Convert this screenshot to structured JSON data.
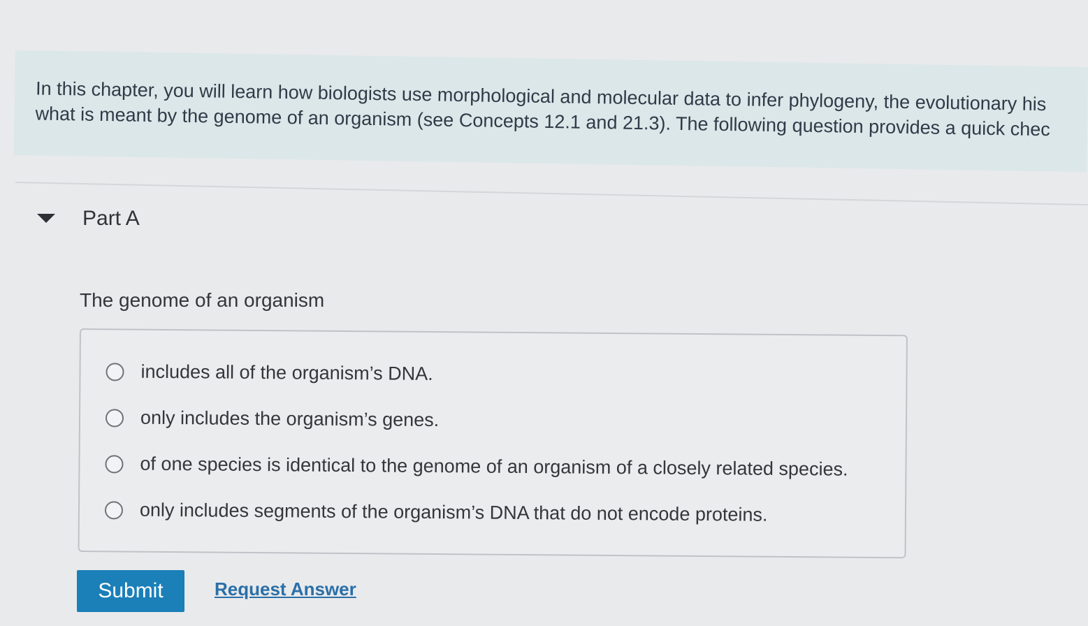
{
  "intro": {
    "line1": "In this chapter, you will learn how biologists use morphological and molecular data to infer phylogeny, the evolutionary his",
    "line2": "what is meant by the genome of an organism (see Concepts 12.1 and 21.3). The following question provides a quick chec"
  },
  "part": {
    "toggle_icon": "caret-down-icon",
    "title": "Part A"
  },
  "question": {
    "stem": "The genome of an organism",
    "choices": [
      {
        "label": "includes all of the organism’s DNA."
      },
      {
        "label": "only includes the organism’s genes."
      },
      {
        "label": "of one species is identical to the genome of an organism of a closely related species."
      },
      {
        "label": "only includes segments of the organism’s DNA that do not encode proteins."
      }
    ]
  },
  "actions": {
    "submit_label": "Submit",
    "request_answer_label": "Request Answer"
  },
  "colors": {
    "banner_bg": "#dbe7e8",
    "submit_bg": "#1b7fb8",
    "link": "#2a6fa8"
  }
}
